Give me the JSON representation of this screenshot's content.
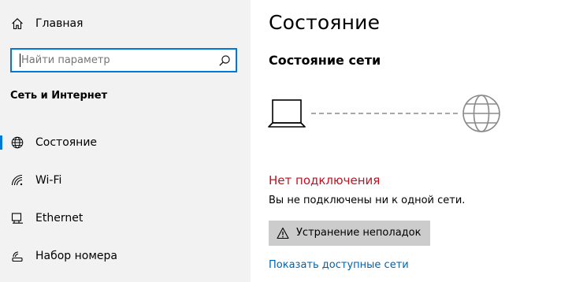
{
  "sidebar": {
    "home_label": "Главная",
    "search_placeholder": "Найти параметр",
    "section_title": "Сеть и Интернет",
    "items": [
      {
        "label": "Состояние",
        "icon": "globe-icon",
        "active": true
      },
      {
        "label": "Wi-Fi",
        "icon": "wifi-icon",
        "active": false
      },
      {
        "label": "Ethernet",
        "icon": "ethernet-icon",
        "active": false
      },
      {
        "label": "Набор номера",
        "icon": "dialup-icon",
        "active": false
      }
    ]
  },
  "main": {
    "title": "Состояние",
    "subtitle": "Состояние сети",
    "status_title": "Нет подключения",
    "status_description": "Вы не подключены ни к одной сети.",
    "troubleshoot_label": "Устранение неполадок",
    "show_networks_label": "Показать доступные сети"
  },
  "colors": {
    "accent": "#0078d7",
    "error": "#c50f1f",
    "link": "#0063b1",
    "sidebar_bg": "#f2f2f2",
    "button_bg": "#cccccc"
  }
}
